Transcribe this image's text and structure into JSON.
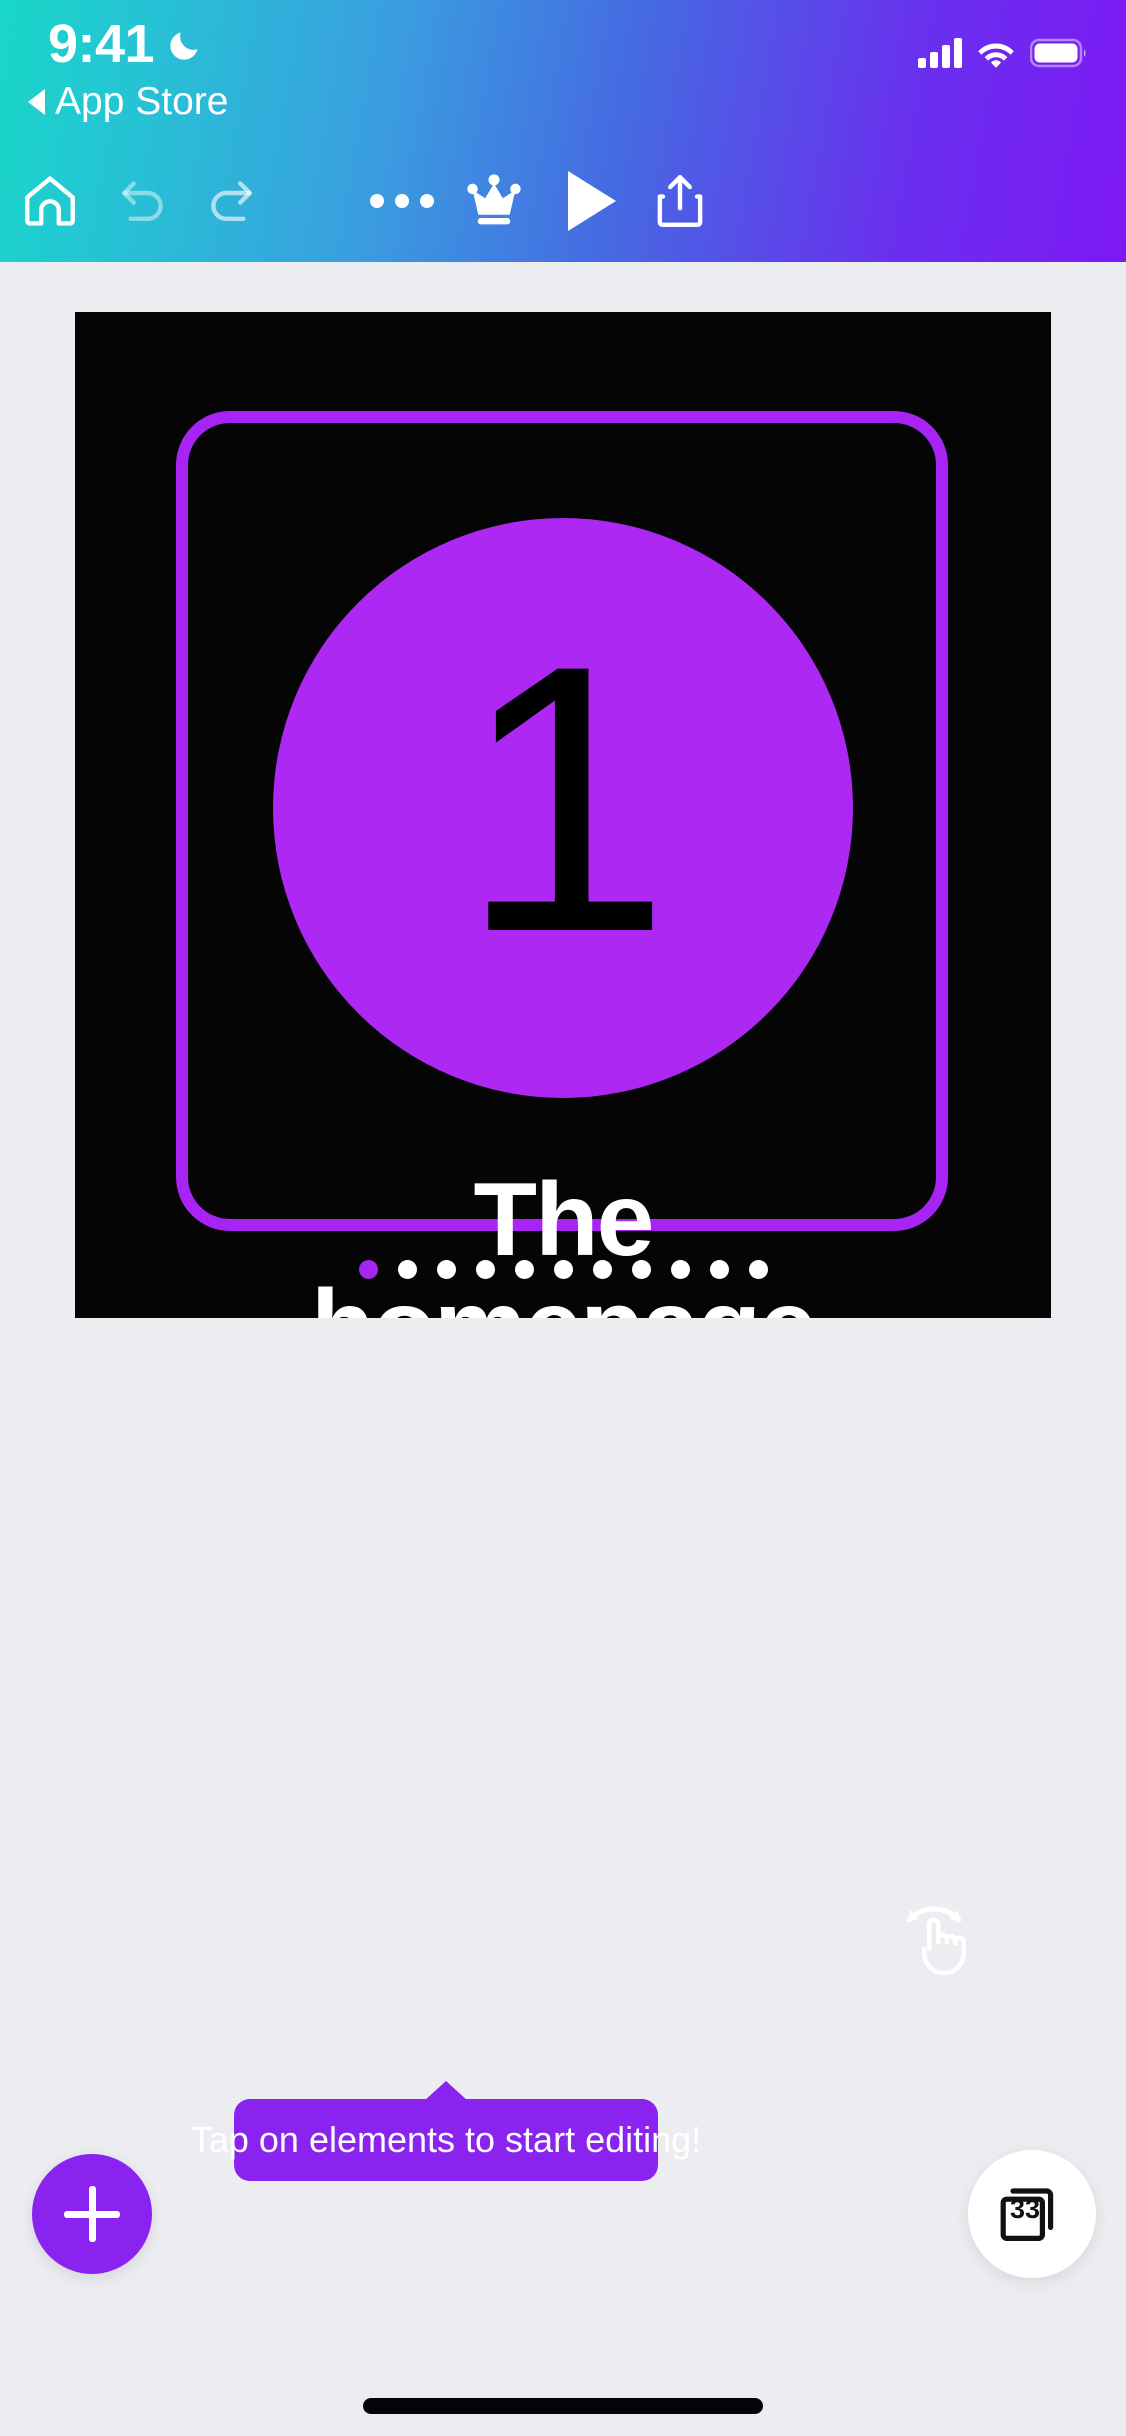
{
  "status_bar": {
    "time": "9:41",
    "moon_icon": "moon-icon",
    "signal_icon": "cellular-signal-icon",
    "wifi_icon": "wifi-icon",
    "battery_icon": "battery-icon"
  },
  "back_link": {
    "label": "App Store",
    "caret_icon": "back-caret-icon"
  },
  "toolbar": {
    "home_icon": "home-icon",
    "undo_icon": "undo-icon",
    "redo_icon": "redo-icon",
    "more_icon": "more-options-icon",
    "crown_icon": "crown-icon",
    "play_icon": "play-icon",
    "share_icon": "share-icon"
  },
  "canvas": {
    "background_color": "#050505",
    "frame_color": "#A824F5",
    "accent_color": "#AD28F2",
    "slide": {
      "number": "1",
      "title_line1": "The",
      "title_line2": "homepage",
      "title": "The homepage"
    },
    "selection_handle": "resize-handle",
    "swipe_hint_icon": "swipe-gesture-icon",
    "pagination": {
      "total": 11,
      "active_index": 0
    }
  },
  "tooltip": {
    "text": "Tap on elements to start editing!",
    "background_color": "#8B23F0"
  },
  "fab_add": {
    "icon": "plus-icon",
    "background_color": "#8B23F0"
  },
  "fab_slides": {
    "count": "33",
    "icon": "slides-stack-icon"
  }
}
